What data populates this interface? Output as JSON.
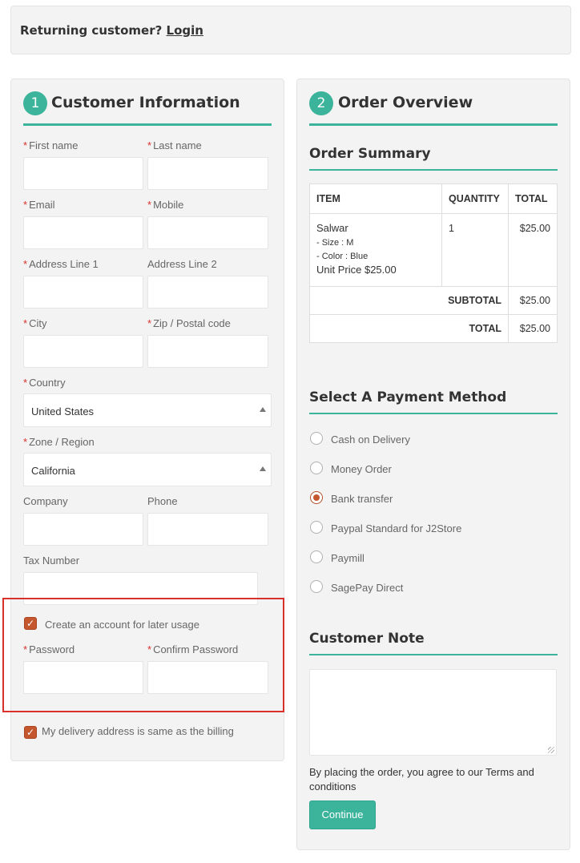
{
  "returning": {
    "text": "Returning customer?",
    "link": "Login"
  },
  "customer": {
    "step": "1",
    "title": "Customer Information",
    "fields": {
      "first_name": "First name",
      "last_name": "Last name",
      "email": "Email",
      "mobile": "Mobile",
      "address1": "Address Line 1",
      "address2": "Address Line 2",
      "city": "City",
      "zip": "Zip / Postal code",
      "country": "Country",
      "country_value": "United States",
      "zone": "Zone / Region",
      "zone_value": "California",
      "company": "Company",
      "phone": "Phone",
      "tax": "Tax Number",
      "create_account": "Create an account for later usage",
      "password": "Password",
      "confirm_password": "Confirm Password",
      "same_delivery": "My delivery address is same as the billing"
    },
    "required_mark": "*"
  },
  "order": {
    "step": "2",
    "title": "Order Overview",
    "summary_title": "Order Summary",
    "table": {
      "headers": [
        "ITEM",
        "QUANTITY",
        "TOTAL"
      ],
      "item_name": "Salwar",
      "item_size": "- Size : M",
      "item_color": "- Color : Blue",
      "item_unit_price": "Unit Price $25.00",
      "quantity": "1",
      "line_total": "$25.00",
      "subtotal_label": "SUBTOTAL",
      "subtotal_value": "$25.00",
      "total_label": "TOTAL",
      "total_value": "$25.00"
    },
    "payment_title": "Select A Payment Method",
    "payment_methods": [
      "Cash on Delivery",
      "Money Order",
      "Bank transfer",
      "Paypal Standard for J2Store",
      "Paymill",
      "SagePay Direct"
    ],
    "selected_payment": "Bank transfer",
    "note_title": "Customer Note",
    "agree_text": "By placing the order, you agree to our Terms and conditions",
    "continue_label": "Continue"
  },
  "colors": {
    "accent": "#3cb49c",
    "checkbox": "#c4572d",
    "required": "#d9302c",
    "highlight": "#d9302c"
  }
}
